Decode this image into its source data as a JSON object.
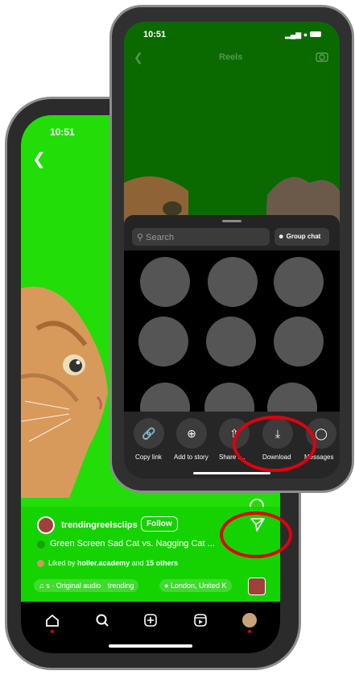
{
  "back_phone": {
    "status_time": "10:51",
    "icons": {
      "back": "chevron-left-icon",
      "comment": "comment-icon",
      "share": "paper-plane-icon"
    },
    "profile": {
      "username": "trendingreelsclips",
      "follow_label": "Follow"
    },
    "caption": "Green Screen Sad Cat vs. Nagging Cat ...",
    "liked_by": {
      "prefix": "Liked by",
      "user": "holler.academy",
      "connector": "and",
      "others": "15 others"
    },
    "audio_chip": "s · Original audio",
    "trending_chip": "trending",
    "location_chip": "London, United K",
    "tab_bar": [
      "home-icon",
      "search-icon",
      "create-icon",
      "reels-icon",
      "profile-avatar"
    ]
  },
  "front_phone": {
    "status_time": "10:51",
    "header_title": "Reels",
    "search_placeholder": "Search",
    "group_chat_label": "Group chat",
    "share_actions": [
      {
        "label": "Copy link",
        "icon": "link-icon",
        "glyph": "🔗"
      },
      {
        "label": "Add to story",
        "icon": "add-story-icon",
        "glyph": "⊕"
      },
      {
        "label": "Share t...",
        "icon": "share-up-icon",
        "glyph": "⇧"
      },
      {
        "label": "Download",
        "icon": "download-icon",
        "glyph": "⤓"
      },
      {
        "label": "Messages",
        "icon": "messages-icon",
        "glyph": "◯"
      }
    ]
  },
  "colors": {
    "highlight_ring": "#e0000f",
    "green_screen": "#22dd08"
  }
}
